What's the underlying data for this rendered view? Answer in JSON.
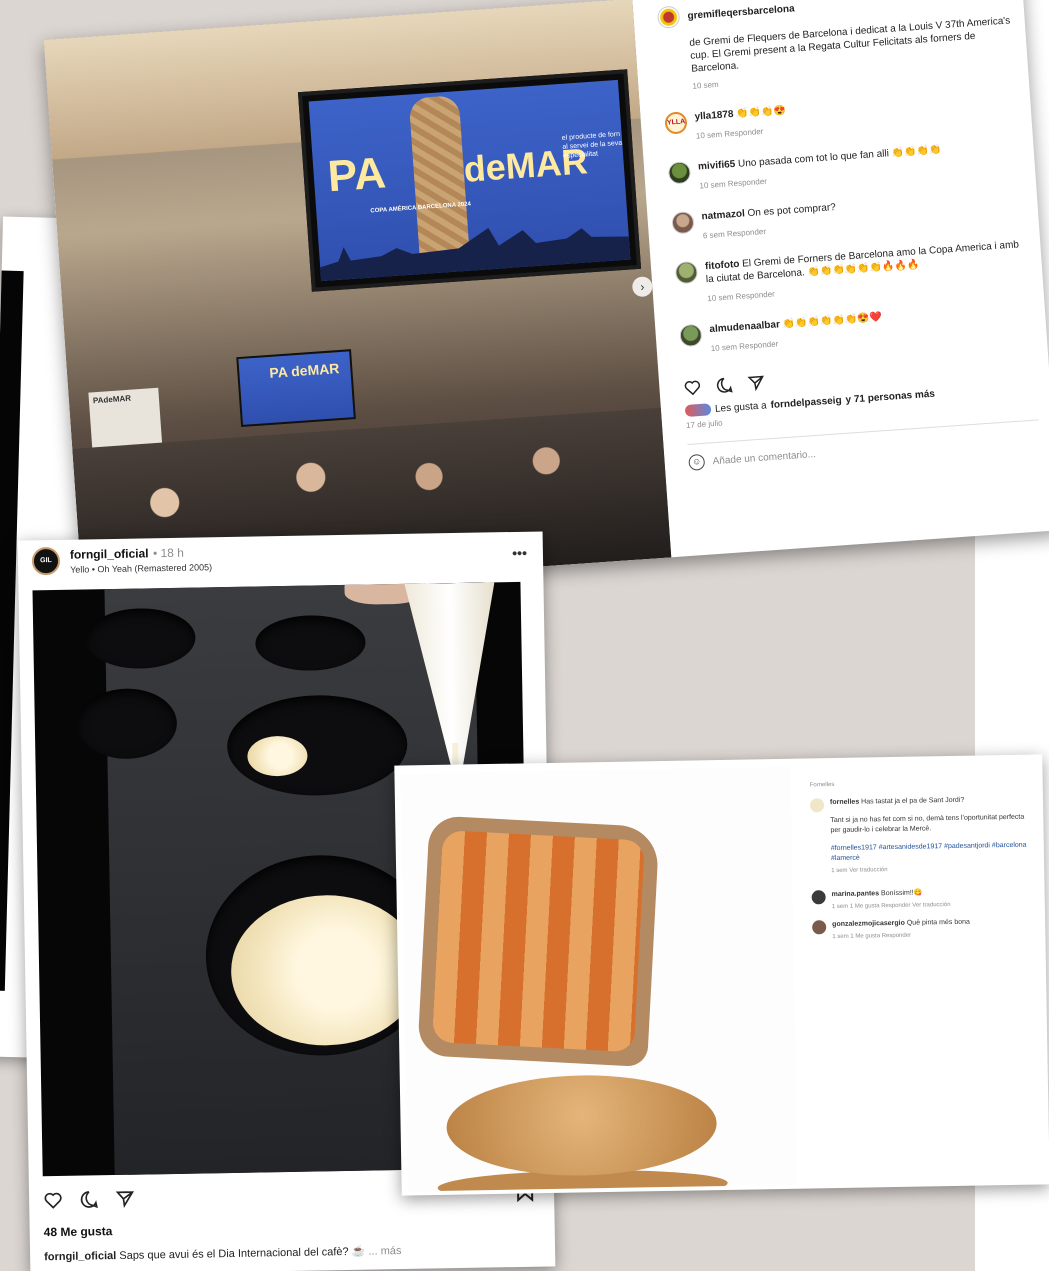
{
  "post_main": {
    "account": "gremifleqersbarcelona",
    "caption": "de Gremi de Flequers de Barcelona i dedicat a la Louis V 37th America's cup. El Gremi present a la Regata Cultur Felicitats als forners de Barcelona.",
    "caption_time": "10 sem",
    "screen": {
      "pa": "PA",
      "demar": "deMAR",
      "small_text": "el producte de forn al servei de la seva especialitat",
      "sub_text": "COPA AMÈRICA BARCELONA 2024",
      "mid_screen": "PA deMAR",
      "panel": "PAdeMAR"
    },
    "comments": [
      {
        "user": "ylla1878",
        "text": "👏👏👏😍",
        "meta": "10 sem  Responder"
      },
      {
        "user": "mivifi65",
        "text": "Uno pasada com tot lo que fan alli 👏👏👏👏",
        "meta": "10 sem  Responder"
      },
      {
        "user": "natmazol",
        "text": "On es pot comprar?",
        "meta": "6 sem  Responder"
      },
      {
        "user": "fitofoto",
        "text": "El Gremi de Forners de Barcelona amo la Copa America i amb la ciutat de Barcelona. 👏👏👏👏👏👏🔥🔥🔥",
        "meta": "10 sem  Responder"
      },
      {
        "user": "almudenaalbar",
        "text": "👏👏👏👏👏👏😍❤️",
        "meta": "10 sem  Responder"
      }
    ],
    "likes_text": "Les gusta a",
    "likes_user": "forndelpasseig",
    "likes_more": "y 71 personas más",
    "date": "17 de julio",
    "add_comment_placeholder": "Añade un comentario..."
  },
  "post_forngil": {
    "username": "forngil_oficial",
    "time": "• 18 h",
    "song": "Yello • Oh Yeah (Remastered 2005)",
    "avatar_text": "GIL",
    "likes": "48 Me gusta",
    "caption_user": "forngil_oficial",
    "caption": "Saps que avui és el Dia Internacional del cafè? ☕",
    "more": "... más"
  },
  "post_bread": {
    "header_note": "Fornelles",
    "comment_user": "fornelles",
    "comment_text": "Has tastat ja el pa de Sant Jordi?",
    "body": "Tant si ja no has fet com si no, demà tens l'oportunitat perfecta per gaudir-lo i celebrar la Mercè.",
    "tags": "#fornelles1917 #artesanidesde1917 #padesantjordi #barcelona #lamercè",
    "body_meta": "1 sem  Ver traducción",
    "replies": [
      {
        "user": "marina.pantes",
        "text": "Boníssim!!😋",
        "meta": "1 sem  1 Me gusta  Responder  Ver traducción"
      },
      {
        "user": "gonzalezmojicasergio",
        "text": "Quê pinta més bona",
        "meta": "1 sem  1 Me gusta  Responder"
      }
    ]
  },
  "icons": [
    "heart-icon",
    "comment-icon",
    "share-icon",
    "save-icon",
    "more-icon",
    "smile-icon"
  ]
}
